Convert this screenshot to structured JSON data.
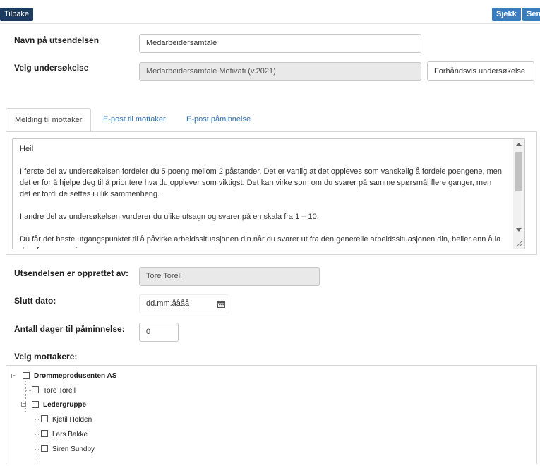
{
  "toolbar": {
    "back_label": "Tilbake",
    "check_label": "Sjekk",
    "send_label": "Sen"
  },
  "form": {
    "name_label": "Navn på utsendelsen",
    "name_value": "Medarbeidersamtale",
    "survey_label": "Velg undersøkelse",
    "survey_value": "Medarbeidersamtale Motivati (v.2021)",
    "preview_label": "Forhåndsvis undersøkelse"
  },
  "tabs": [
    {
      "label": "Melding til mottaker"
    },
    {
      "label": "E-post til mottaker"
    },
    {
      "label": "E-post påminnelse"
    }
  ],
  "message": {
    "paragraphs": [
      "Hei!",
      "I første del av undersøkelsen fordeler du 5 poeng mellom 2 påstander. Det er vanlig at det oppleves som vanskelig å fordele poengene, men det er for å hjelpe deg til å prioritere hva du opplever som viktigst. Det kan virke som om du svarer på samme spørsmål flere ganger, men det er fordi de settes i ulik sammenheng.",
      "I andre del av undersøkelsen vurderer du ulike utsagn og svarer på en skala fra 1 – 10.",
      "Du får det beste utgangspunktet til å påvirke arbeidssituasjonen din når du svarer ut fra den generelle arbeidssituasjonen din, heller enn å la dagsformen avgjøre."
    ]
  },
  "created_by": {
    "label": "Utsendelsen er opprettet av:",
    "value": "Tore Torell"
  },
  "end_date": {
    "label": "Slutt dato:",
    "placeholder": "dd.mm.åååå",
    "icon": "calendar-icon"
  },
  "reminder_days": {
    "label": "Antall dager til påminnelse:",
    "value": "0"
  },
  "recipients": {
    "label": "Velg mottakere:",
    "tree": {
      "company": "Drømmeprodusenten AS",
      "person_top": "Tore Torell",
      "group": "Ledergruppe",
      "members": [
        "Kjetil Holden",
        "Lars Bakke",
        "Siren Sundby"
      ]
    }
  }
}
